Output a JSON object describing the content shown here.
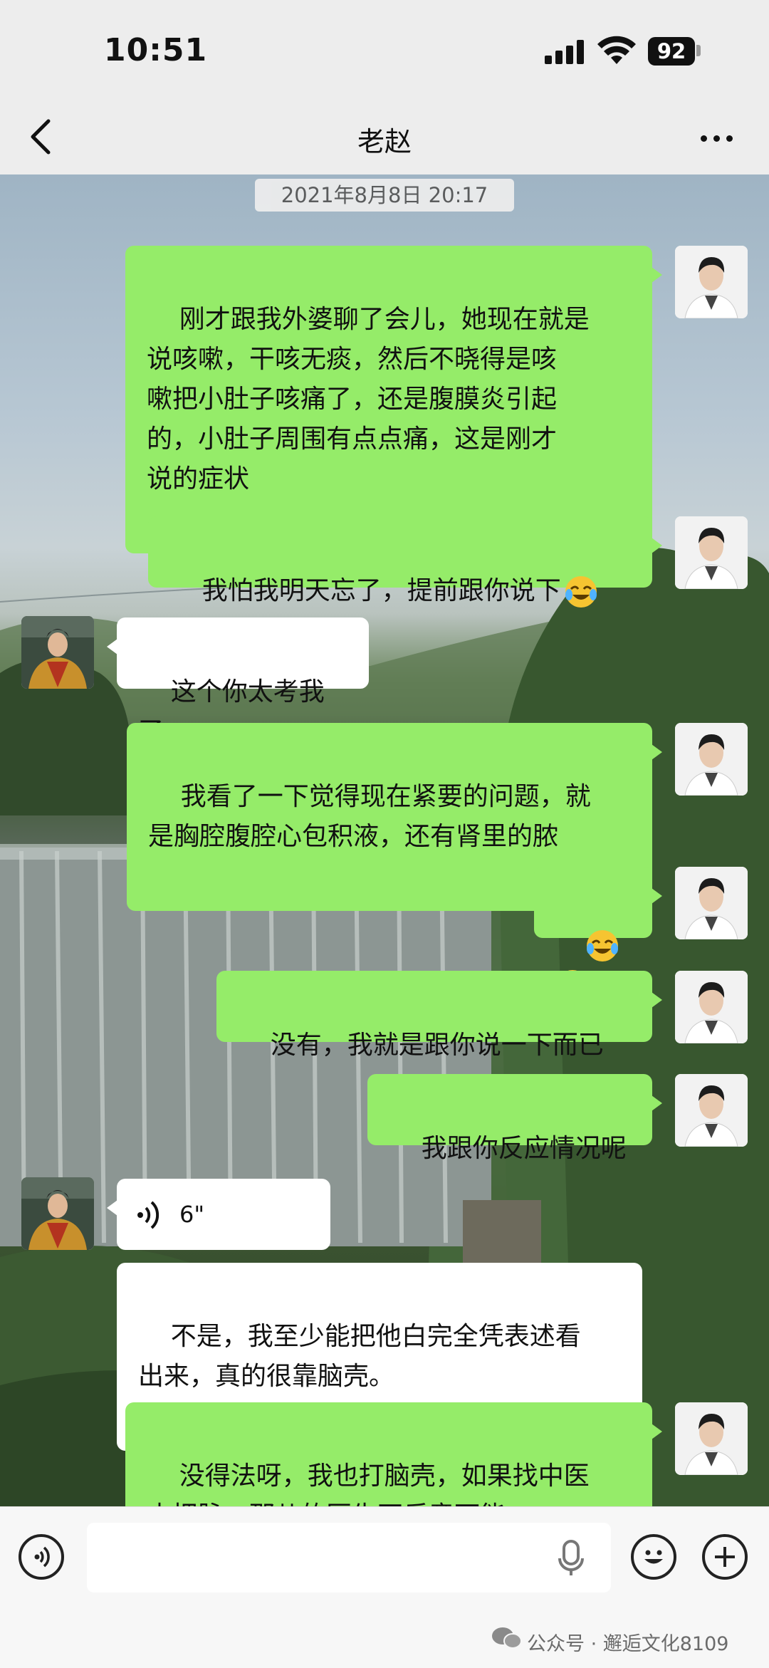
{
  "status_bar": {
    "time": "10:51",
    "battery": "92"
  },
  "nav": {
    "title": "老赵"
  },
  "chat": {
    "timestamp": "2021年8月8日 20:17",
    "messages": [
      {
        "side": "right",
        "text": "刚才跟我外婆聊了会儿，她现在就是\n说咳嗽，干咳无痰，然后不晓得是咳\n嗽把小肚子咳痛了，还是腹膜炎引起\n的，小肚子周围有点点痛，这是刚才\n说的症状"
      },
      {
        "side": "right",
        "text": "我怕我明天忘了，提前跟你说下",
        "emoji": "crying-laughing-emoji"
      },
      {
        "side": "left",
        "text": "这个你太考我了"
      },
      {
        "side": "right",
        "text": "我看了一下觉得现在紧要的问题，就\n是胸腔腹腔心包积液，还有肾里的脓"
      },
      {
        "side": "right",
        "text": "",
        "emoji": "crying-laughing-emoji x2"
      },
      {
        "side": "right",
        "text": "没有，我就是跟你说一下而已"
      },
      {
        "side": "right",
        "text": "我跟你反应情况呢"
      },
      {
        "side": "left",
        "voice": "6\""
      },
      {
        "side": "left",
        "text": "不是，我至少能把他白完全凭表述看\n出来，真的很靠脑壳。"
      },
      {
        "side": "right",
        "text": "没得法呀，我也打脑壳，如果找中医\n去把脉，那儿的医生不乐意可能"
      }
    ]
  },
  "input_bar": {
    "placeholder": "",
    "watermark": "公众号 · 邂逅文化8109"
  },
  "colors": {
    "bubble_sent": "#95ec69",
    "bubble_received": "#ffffff",
    "bar_bg": "#ededed"
  }
}
